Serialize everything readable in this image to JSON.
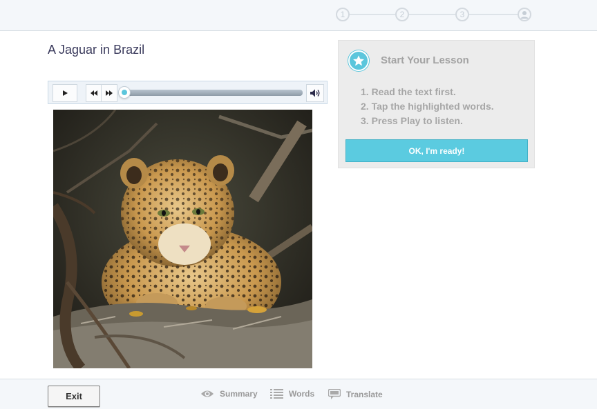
{
  "progress": {
    "steps": [
      "1",
      "2",
      "3"
    ],
    "final_step_icon": "avatar-icon"
  },
  "lesson": {
    "title": "A Jaguar in Brazil"
  },
  "player": {
    "play_icon": "play-icon",
    "rewind_icon": "rewind-icon",
    "forward_icon": "fast-forward-icon",
    "volume_icon": "volume-icon",
    "position_fraction": 0.0,
    "accent_color": "#5bc6dc"
  },
  "photo": {
    "subject": "jaguar-photo"
  },
  "panel": {
    "icon": "star-icon",
    "title": "Start Your Lesson",
    "instructions": [
      "1. Read the text first.",
      "2. Tap the highlighted words.",
      "3. Press Play to listen."
    ],
    "ready_button": "OK, I'm ready!",
    "button_color": "#5bcbe0"
  },
  "bottom": {
    "exit": "Exit",
    "summary": "Summary",
    "words": "Words",
    "translate": "Translate"
  }
}
